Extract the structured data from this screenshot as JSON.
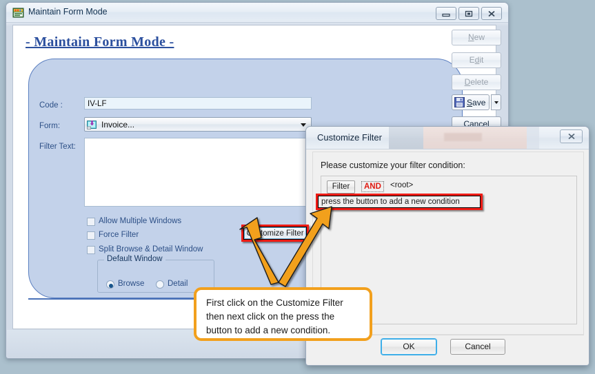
{
  "main_window": {
    "title": "Maintain Form Mode",
    "title_icon": "application-window-icon",
    "controls": {
      "minimize": "minimize-icon",
      "maximize": "restore-icon",
      "close": "close-icon"
    },
    "page_heading": "- Maintain Form Mode -",
    "fields": {
      "code_label": "Code :",
      "code_value": "IV-LF",
      "form_label": "Form:",
      "form_value": "Invoice...",
      "form_icon": "invoice-form-icon",
      "filter_label": "Filter Text:",
      "filter_value": ""
    },
    "checkboxes": [
      {
        "label": "Allow Multiple Windows",
        "checked": false
      },
      {
        "label": "Force Filter",
        "checked": false
      },
      {
        "label": "Split Browse & Detail Window",
        "checked": false
      }
    ],
    "default_window": {
      "legend": "Default Window",
      "options": [
        {
          "label": "Browse",
          "selected": true
        },
        {
          "label": "Detail",
          "selected": false
        }
      ]
    },
    "customize_filter_button": "Customize Filter",
    "command_buttons": [
      {
        "label": "New",
        "mnemonic": "N",
        "enabled": false
      },
      {
        "label": "Edit",
        "mnemonic": "d",
        "enabled": false
      },
      {
        "label": "Delete",
        "mnemonic": "D",
        "enabled": false
      },
      {
        "label": "Save",
        "mnemonic": "S",
        "enabled": true,
        "icon": "floppy-save-icon",
        "has_split": true
      },
      {
        "label": "Cancel",
        "mnemonic": "C",
        "enabled": true
      }
    ]
  },
  "filter_dialog": {
    "title": "Customize Filter",
    "close_icon": "close-icon",
    "prompt": "Please customize your filter condition:",
    "node": {
      "filter_button": "Filter",
      "operator": "AND",
      "root": "<root>"
    },
    "add_condition_text": "press the button to add a new condition",
    "buttons": {
      "ok": "OK",
      "cancel": "Cancel"
    }
  },
  "annotation": {
    "callout_lines": [
      "First click on the Customize Filter",
      "then next click on the press the",
      "button to add a new condition."
    ],
    "arrow_color": "#f2a01d",
    "highlight_color": "#ee1b15",
    "callout_border_color": "#f2a01d"
  },
  "colors": {
    "desktop_background": "#abc0cd",
    "panel_blue": "#c3d2ea",
    "panel_border_blue": "#5b7fc0",
    "heading_blue": "#2b4f9e",
    "label_blue": "#2c4f86",
    "and_red": "#e01b12"
  }
}
